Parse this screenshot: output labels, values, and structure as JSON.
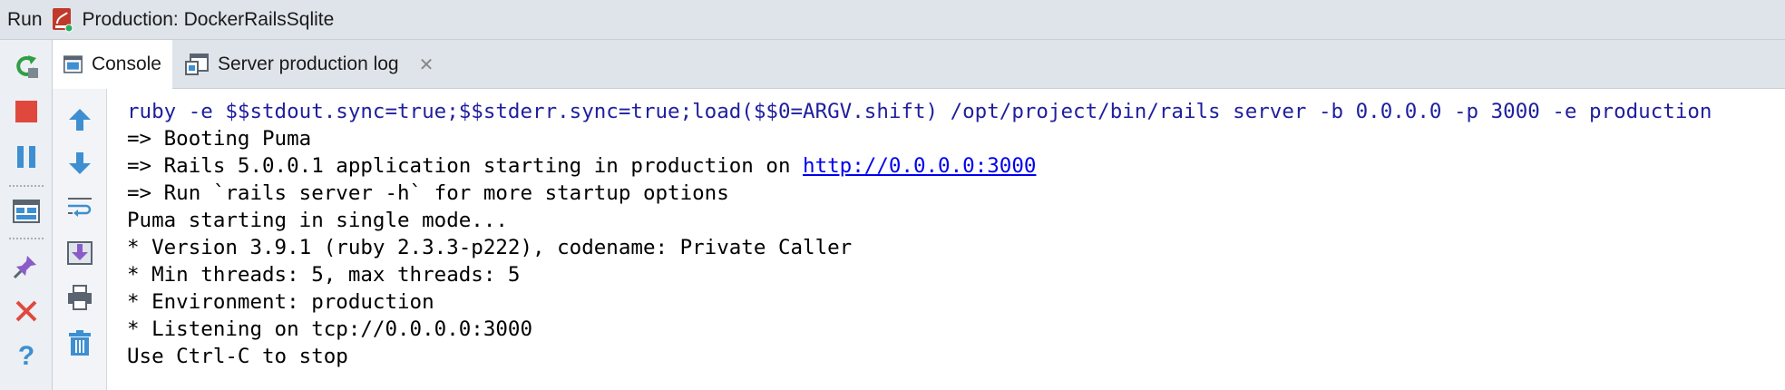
{
  "titlebar": {
    "run_label": "Run",
    "config_name": "Production: DockerRailsSqlite"
  },
  "tabs": [
    {
      "label": "Console",
      "active": true
    },
    {
      "label": "Server production log",
      "active": false,
      "close": "✕"
    }
  ],
  "console": {
    "command": "ruby -e $$stdout.sync=true;$$stderr.sync=true;load($$0=ARGV.shift) /opt/project/bin/rails server -b 0.0.0.0 -p 3000 -e production",
    "lines": [
      "=> Booting Puma"
    ],
    "rails_line_prefix": "=> Rails 5.0.0.1 application starting in production on ",
    "rails_line_link": "http://0.0.0.0:3000",
    "lines_after": [
      "=> Run `rails server -h` for more startup options",
      "Puma starting in single mode...",
      "* Version 3.9.1 (ruby 2.3.3-p222), codename: Private Caller",
      "* Min threads: 5, max threads: 5",
      "* Environment: production",
      "* Listening on tcp://0.0.0.0:3000",
      "Use Ctrl-C to stop"
    ]
  },
  "colors": {
    "accent_green": "#2f9e44",
    "stop_red": "#e0483d",
    "pause_blue": "#3d8fd1",
    "command_text": "#1f1f9e",
    "link": "#0000ee"
  }
}
